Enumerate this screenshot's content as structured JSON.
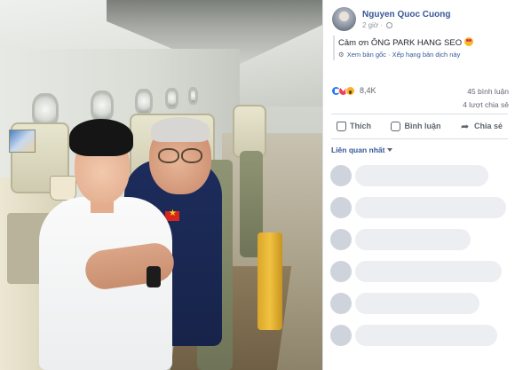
{
  "post": {
    "author": "Nguyen Quoc Cuong",
    "time": "2 giờ",
    "caption": "Cảm ơn ÔNG PARK HANG SEO",
    "caption_emoji": "star-struck-emoji",
    "see_original": "Xem bản gốc",
    "separator": "·",
    "rate_translation": "Xếp hạng bản dịch này"
  },
  "stats": {
    "reaction_icons": [
      "like-icon",
      "love-icon",
      "wow-icon"
    ],
    "reactions": "8,4K",
    "comments": "45 bình luận",
    "shares": "4 lượt chia sẻ"
  },
  "actions": {
    "like": "Thích",
    "comment": "Bình luận",
    "share": "Chia sẻ"
  },
  "comments_filter": "Liên quan nhất",
  "colors": {
    "link": "#385898",
    "secondary_text": "#606770",
    "like_blue": "#2078f4",
    "love_red": "#f33e58",
    "wow_yellow": "#f7b125"
  }
}
